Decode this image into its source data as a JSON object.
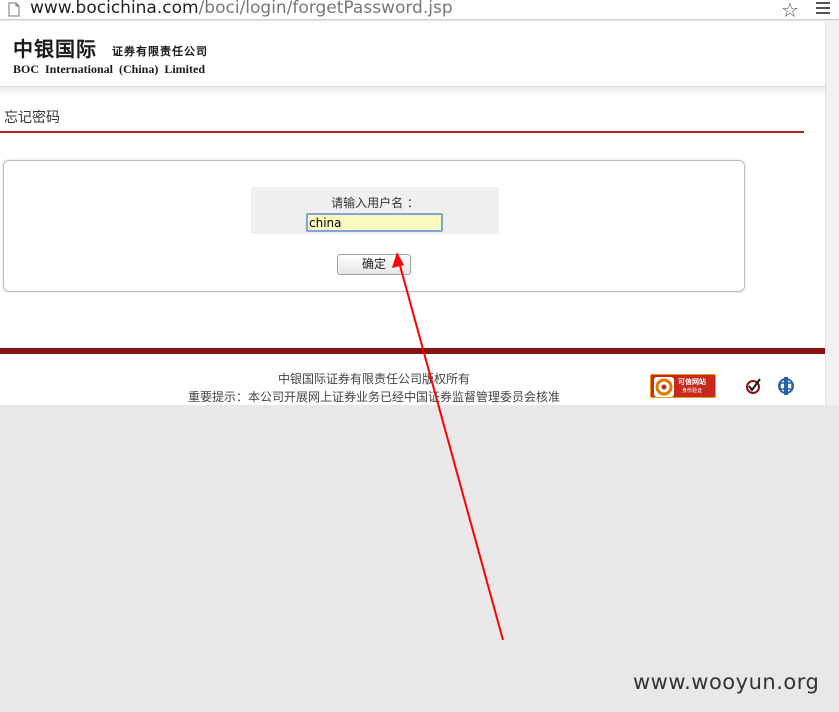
{
  "browser": {
    "url_host": "www.bocichina.com",
    "url_path": "/boci/login/forgetPassword.jsp"
  },
  "header": {
    "logo_cn": "中银国际",
    "logo_sub": "证券有限责任公司",
    "logo_en": "BOC International (China) Limited"
  },
  "section": {
    "title": "忘记密码"
  },
  "form": {
    "label": "请输入用户名 ：",
    "username_value": "china",
    "confirm_label": "确定"
  },
  "footer": {
    "line1": "中银国际证券有限责任公司版权所有",
    "line2": "重要提示：本公司开展网上证券业务已经中国证券监督管理委员会核准",
    "badge_title": "可信网站",
    "badge_sub": "身份验证"
  },
  "watermark": "www.wooyun.org",
  "colors": {
    "brand_red": "#8b1010",
    "title_line": "#b22222",
    "annotation_arrow": "#ff0000"
  },
  "icons": [
    "page-icon",
    "star-icon",
    "menu-icon",
    "check-icon",
    "csrc-icon"
  ]
}
